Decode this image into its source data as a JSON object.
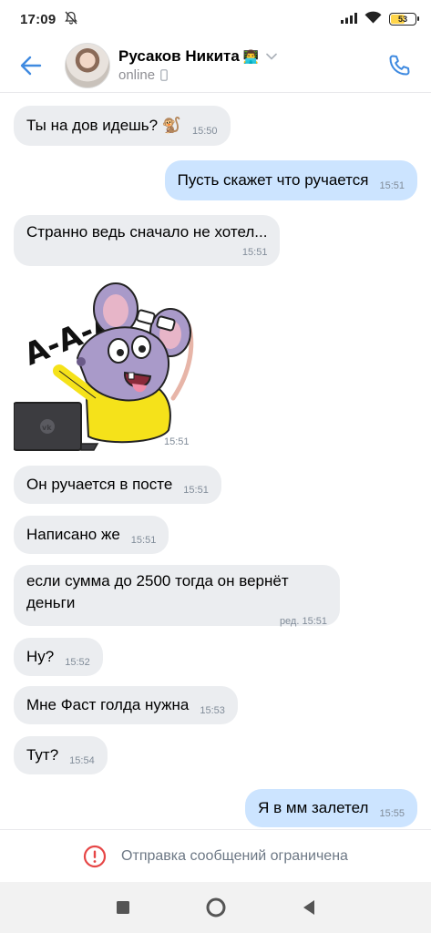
{
  "status_bar": {
    "time": "17:09",
    "battery": "53",
    "icons": [
      "mute-icon",
      "signal-icon",
      "wifi-icon",
      "battery-icon"
    ]
  },
  "header": {
    "contact_name": "Русаков Никита",
    "name_emoji": "👨‍💻",
    "status": "online",
    "status_device_icon": "mobile-icon"
  },
  "messages": [
    {
      "dir": "in",
      "text": "Ты на дов идешь? 🐒",
      "time": "15:50"
    },
    {
      "dir": "out",
      "text": "Пусть скажет что ручается",
      "time": "15:51"
    },
    {
      "dir": "in",
      "text": "Странно ведь сначало не хотел...",
      "time": "15:51"
    },
    {
      "dir": "in",
      "type": "sticker",
      "sticker_text": "А-А-А!",
      "time": "15:51"
    },
    {
      "dir": "in",
      "text": "Он ручается в посте",
      "time": "15:51"
    },
    {
      "dir": "in",
      "text": "Написано же",
      "time": "15:51"
    },
    {
      "dir": "in",
      "text": "если сумма до 2500 тогда он вернёт деньги",
      "time": "ред. 15:51"
    },
    {
      "dir": "in",
      "text": "Ну?",
      "time": "15:52"
    },
    {
      "dir": "in",
      "text": "Мне Фаст голда нужна",
      "time": "15:53"
    },
    {
      "dir": "in",
      "text": "Тут?",
      "time": "15:54"
    },
    {
      "dir": "out",
      "text": "Я в мм залетел",
      "time": "15:55"
    }
  ],
  "restriction": {
    "text": "Отправка сообщений ограничена"
  },
  "colors": {
    "accent": "#3f8ae0",
    "incoming_bubble": "#ebedf0",
    "outgoing_bubble": "#cce4ff",
    "warning": "#e64646"
  }
}
